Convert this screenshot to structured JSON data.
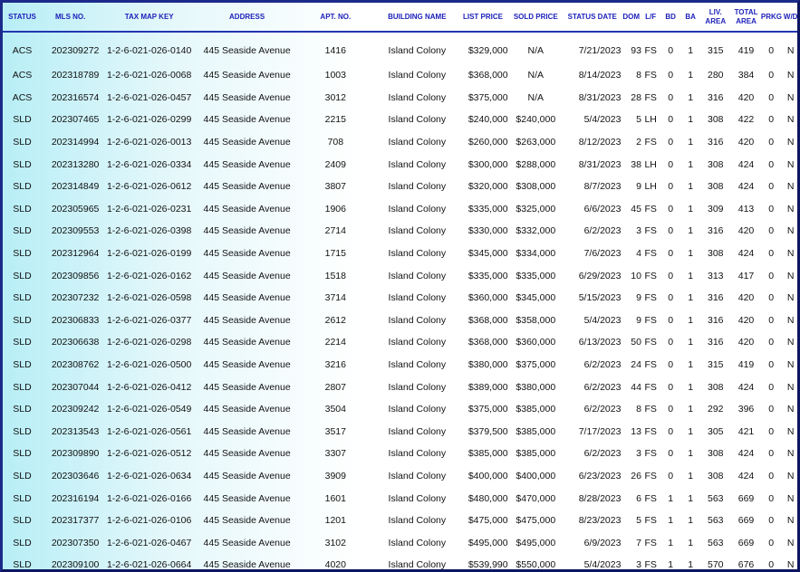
{
  "headers": {
    "status": "STATUS",
    "mls": "MLS NO.",
    "tmk": "TAX MAP KEY",
    "address": "ADDRESS",
    "apt": "APT. NO.",
    "building": "BUILDING NAME",
    "list": "LIST PRICE",
    "sold": "SOLD PRICE",
    "date": "STATUS DATE",
    "dom": "DOM",
    "lf": "L/F",
    "bd": "BD",
    "ba": "BA",
    "liv": "LIV. AREA",
    "total": "TOTAL AREA",
    "prkg": "PRKG",
    "wd": "W/D"
  },
  "rows": [
    {
      "status": "ACS",
      "mls": "202309272",
      "tmk": "1-2-6-021-026-0140",
      "address": "445 Seaside Avenue",
      "apt": "1416",
      "building": "Island Colony",
      "list": "$329,000",
      "sold": "N/A",
      "date": "7/21/2023",
      "dom": "93",
      "lf": "FS",
      "bd": "0",
      "ba": "1",
      "liv": "315",
      "total": "419",
      "prkg": "0",
      "wd": "N"
    },
    {
      "status": "ACS",
      "mls": "202318789",
      "tmk": "1-2-6-021-026-0068",
      "address": "445 Seaside Avenue",
      "apt": "1003",
      "building": "Island Colony",
      "list": "$368,000",
      "sold": "N/A",
      "date": "8/14/2023",
      "dom": "8",
      "lf": "FS",
      "bd": "0",
      "ba": "1",
      "liv": "280",
      "total": "384",
      "prkg": "0",
      "wd": "N"
    },
    {
      "status": "ACS",
      "mls": "202316574",
      "tmk": "1-2-6-021-026-0457",
      "address": "445 Seaside Avenue",
      "apt": "3012",
      "building": "Island Colony",
      "list": "$375,000",
      "sold": "N/A",
      "date": "8/31/2023",
      "dom": "28",
      "lf": "FS",
      "bd": "0",
      "ba": "1",
      "liv": "316",
      "total": "420",
      "prkg": "0",
      "wd": "N"
    },
    {
      "status": "SLD",
      "mls": "202307465",
      "tmk": "1-2-6-021-026-0299",
      "address": "445 Seaside Avenue",
      "apt": "2215",
      "building": "Island Colony",
      "list": "$240,000",
      "sold": "$240,000",
      "date": "5/4/2023",
      "dom": "5",
      "lf": "LH",
      "bd": "0",
      "ba": "1",
      "liv": "308",
      "total": "422",
      "prkg": "0",
      "wd": "N"
    },
    {
      "status": "SLD",
      "mls": "202314994",
      "tmk": "1-2-6-021-026-0013",
      "address": "445 Seaside Avenue",
      "apt": "708",
      "building": "Island Colony",
      "list": "$260,000",
      "sold": "$263,000",
      "date": "8/12/2023",
      "dom": "2",
      "lf": "FS",
      "bd": "0",
      "ba": "1",
      "liv": "316",
      "total": "420",
      "prkg": "0",
      "wd": "N"
    },
    {
      "status": "SLD",
      "mls": "202313280",
      "tmk": "1-2-6-021-026-0334",
      "address": "445 Seaside Avenue",
      "apt": "2409",
      "building": "Island Colony",
      "list": "$300,000",
      "sold": "$288,000",
      "date": "8/31/2023",
      "dom": "38",
      "lf": "LH",
      "bd": "0",
      "ba": "1",
      "liv": "308",
      "total": "424",
      "prkg": "0",
      "wd": "N"
    },
    {
      "status": "SLD",
      "mls": "202314849",
      "tmk": "1-2-6-021-026-0612",
      "address": "445 Seaside Avenue",
      "apt": "3807",
      "building": "Island Colony",
      "list": "$320,000",
      "sold": "$308,000",
      "date": "8/7/2023",
      "dom": "9",
      "lf": "LH",
      "bd": "0",
      "ba": "1",
      "liv": "308",
      "total": "424",
      "prkg": "0",
      "wd": "N"
    },
    {
      "status": "SLD",
      "mls": "202305965",
      "tmk": "1-2-6-021-026-0231",
      "address": "445 Seaside Avenue",
      "apt": "1906",
      "building": "Island Colony",
      "list": "$335,000",
      "sold": "$325,000",
      "date": "6/6/2023",
      "dom": "45",
      "lf": "FS",
      "bd": "0",
      "ba": "1",
      "liv": "309",
      "total": "413",
      "prkg": "0",
      "wd": "N"
    },
    {
      "status": "SLD",
      "mls": "202309553",
      "tmk": "1-2-6-021-026-0398",
      "address": "445 Seaside Avenue",
      "apt": "2714",
      "building": "Island Colony",
      "list": "$330,000",
      "sold": "$332,000",
      "date": "6/2/2023",
      "dom": "3",
      "lf": "FS",
      "bd": "0",
      "ba": "1",
      "liv": "316",
      "total": "420",
      "prkg": "0",
      "wd": "N"
    },
    {
      "status": "SLD",
      "mls": "202312964",
      "tmk": "1-2-6-021-026-0199",
      "address": "445 Seaside Avenue",
      "apt": "1715",
      "building": "Island Colony",
      "list": "$345,000",
      "sold": "$334,000",
      "date": "7/6/2023",
      "dom": "4",
      "lf": "FS",
      "bd": "0",
      "ba": "1",
      "liv": "308",
      "total": "424",
      "prkg": "0",
      "wd": "N"
    },
    {
      "status": "SLD",
      "mls": "202309856",
      "tmk": "1-2-6-021-026-0162",
      "address": "445 Seaside Avenue",
      "apt": "1518",
      "building": "Island Colony",
      "list": "$335,000",
      "sold": "$335,000",
      "date": "6/29/2023",
      "dom": "10",
      "lf": "FS",
      "bd": "0",
      "ba": "1",
      "liv": "313",
      "total": "417",
      "prkg": "0",
      "wd": "N"
    },
    {
      "status": "SLD",
      "mls": "202307232",
      "tmk": "1-2-6-021-026-0598",
      "address": "445 Seaside Avenue",
      "apt": "3714",
      "building": "Island Colony",
      "list": "$360,000",
      "sold": "$345,000",
      "date": "5/15/2023",
      "dom": "9",
      "lf": "FS",
      "bd": "0",
      "ba": "1",
      "liv": "316",
      "total": "420",
      "prkg": "0",
      "wd": "N"
    },
    {
      "status": "SLD",
      "mls": "202306833",
      "tmk": "1-2-6-021-026-0377",
      "address": "445 Seaside Avenue",
      "apt": "2612",
      "building": "Island Colony",
      "list": "$368,000",
      "sold": "$358,000",
      "date": "5/4/2023",
      "dom": "9",
      "lf": "FS",
      "bd": "0",
      "ba": "1",
      "liv": "316",
      "total": "420",
      "prkg": "0",
      "wd": "N"
    },
    {
      "status": "SLD",
      "mls": "202306638",
      "tmk": "1-2-6-021-026-0298",
      "address": "445 Seaside Avenue",
      "apt": "2214",
      "building": "Island Colony",
      "list": "$368,000",
      "sold": "$360,000",
      "date": "6/13/2023",
      "dom": "50",
      "lf": "FS",
      "bd": "0",
      "ba": "1",
      "liv": "316",
      "total": "420",
      "prkg": "0",
      "wd": "N"
    },
    {
      "status": "SLD",
      "mls": "202308762",
      "tmk": "1-2-6-021-026-0500",
      "address": "445 Seaside Avenue",
      "apt": "3216",
      "building": "Island Colony",
      "list": "$380,000",
      "sold": "$375,000",
      "date": "6/2/2023",
      "dom": "24",
      "lf": "FS",
      "bd": "0",
      "ba": "1",
      "liv": "315",
      "total": "419",
      "prkg": "0",
      "wd": "N"
    },
    {
      "status": "SLD",
      "mls": "202307044",
      "tmk": "1-2-6-021-026-0412",
      "address": "445 Seaside Avenue",
      "apt": "2807",
      "building": "Island Colony",
      "list": "$389,000",
      "sold": "$380,000",
      "date": "6/2/2023",
      "dom": "44",
      "lf": "FS",
      "bd": "0",
      "ba": "1",
      "liv": "308",
      "total": "424",
      "prkg": "0",
      "wd": "N"
    },
    {
      "status": "SLD",
      "mls": "202309242",
      "tmk": "1-2-6-021-026-0549",
      "address": "445 Seaside Avenue",
      "apt": "3504",
      "building": "Island Colony",
      "list": "$375,000",
      "sold": "$385,000",
      "date": "6/2/2023",
      "dom": "8",
      "lf": "FS",
      "bd": "0",
      "ba": "1",
      "liv": "292",
      "total": "396",
      "prkg": "0",
      "wd": "N"
    },
    {
      "status": "SLD",
      "mls": "202313543",
      "tmk": "1-2-6-021-026-0561",
      "address": "445 Seaside Avenue",
      "apt": "3517",
      "building": "Island Colony",
      "list": "$379,500",
      "sold": "$385,000",
      "date": "7/17/2023",
      "dom": "13",
      "lf": "FS",
      "bd": "0",
      "ba": "1",
      "liv": "305",
      "total": "421",
      "prkg": "0",
      "wd": "N"
    },
    {
      "status": "SLD",
      "mls": "202309890",
      "tmk": "1-2-6-021-026-0512",
      "address": "445 Seaside Avenue",
      "apt": "3307",
      "building": "Island Colony",
      "list": "$385,000",
      "sold": "$385,000",
      "date": "6/2/2023",
      "dom": "3",
      "lf": "FS",
      "bd": "0",
      "ba": "1",
      "liv": "308",
      "total": "424",
      "prkg": "0",
      "wd": "N"
    },
    {
      "status": "SLD",
      "mls": "202303646",
      "tmk": "1-2-6-021-026-0634",
      "address": "445 Seaside Avenue",
      "apt": "3909",
      "building": "Island Colony",
      "list": "$400,000",
      "sold": "$400,000",
      "date": "6/23/2023",
      "dom": "26",
      "lf": "FS",
      "bd": "0",
      "ba": "1",
      "liv": "308",
      "total": "424",
      "prkg": "0",
      "wd": "N"
    },
    {
      "status": "SLD",
      "mls": "202316194",
      "tmk": "1-2-6-021-026-0166",
      "address": "445 Seaside Avenue",
      "apt": "1601",
      "building": "Island Colony",
      "list": "$480,000",
      "sold": "$470,000",
      "date": "8/28/2023",
      "dom": "6",
      "lf": "FS",
      "bd": "1",
      "ba": "1",
      "liv": "563",
      "total": "669",
      "prkg": "0",
      "wd": "N"
    },
    {
      "status": "SLD",
      "mls": "202317377",
      "tmk": "1-2-6-021-026-0106",
      "address": "445 Seaside Avenue",
      "apt": "1201",
      "building": "Island Colony",
      "list": "$475,000",
      "sold": "$475,000",
      "date": "8/23/2023",
      "dom": "5",
      "lf": "FS",
      "bd": "1",
      "ba": "1",
      "liv": "563",
      "total": "669",
      "prkg": "0",
      "wd": "N"
    },
    {
      "status": "SLD",
      "mls": "202307350",
      "tmk": "1-2-6-021-026-0467",
      "address": "445 Seaside Avenue",
      "apt": "3102",
      "building": "Island Colony",
      "list": "$495,000",
      "sold": "$495,000",
      "date": "6/9/2023",
      "dom": "7",
      "lf": "FS",
      "bd": "1",
      "ba": "1",
      "liv": "563",
      "total": "669",
      "prkg": "0",
      "wd": "N"
    },
    {
      "status": "SLD",
      "mls": "202309100",
      "tmk": "1-2-6-021-026-0664",
      "address": "445 Seaside Avenue",
      "apt": "4020",
      "building": "Island Colony",
      "list": "$539,990",
      "sold": "$550,000",
      "date": "5/4/2023",
      "dom": "3",
      "lf": "FS",
      "bd": "1",
      "ba": "1",
      "liv": "570",
      "total": "676",
      "prkg": "0",
      "wd": "N"
    }
  ]
}
